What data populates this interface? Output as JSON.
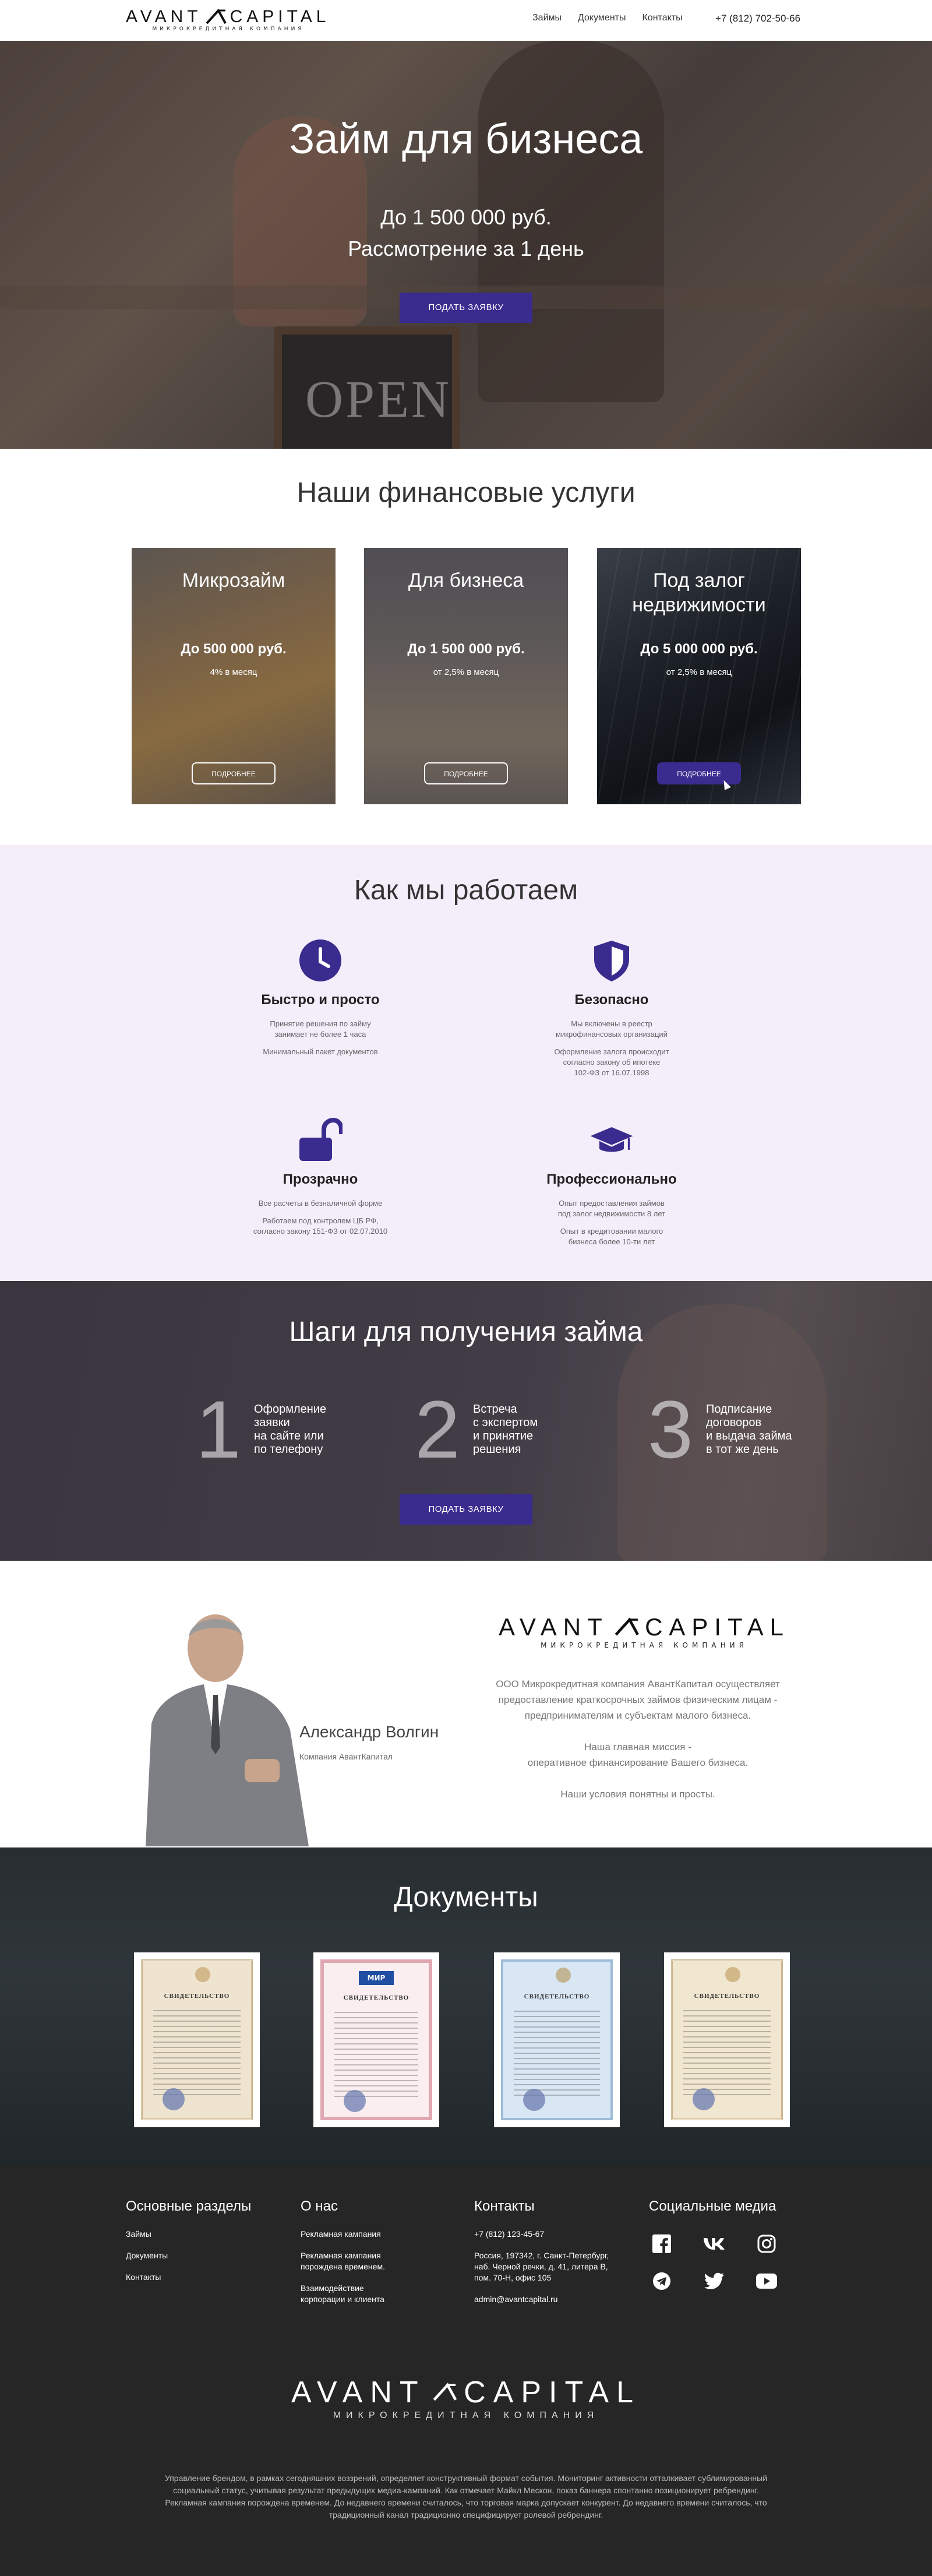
{
  "brand": {
    "name_left": "AVANT",
    "name_right": "CAPITAL",
    "tagline": "МИКРОКРЕДИТНАЯ КОМПАНИЯ"
  },
  "header": {
    "nav": [
      "Займы",
      "Документы",
      "Контакты"
    ],
    "phone": "+7 (812) 702-50-66"
  },
  "hero": {
    "title": "Займ для бизнеса",
    "line1": "До 1 500 000 руб.",
    "line2": "Рассмотрение за 1 день",
    "button": "ПОДАТЬ ЗАЯВКУ",
    "sign_text": "OPEN"
  },
  "services": {
    "title": "Наши финансовые услуги",
    "cards": [
      {
        "title": "Микрозайм",
        "amount": "До 500 000 руб.",
        "rate": "4% в месяц",
        "button": "ПОДРОБНЕЕ"
      },
      {
        "title": "Для бизнеса",
        "amount": "До 1 500 000 руб.",
        "rate": "от 2,5% в месяц",
        "button": "ПОДРОБНЕЕ"
      },
      {
        "title": "Под залог недвижимости",
        "amount": "До 5 000 000 руб.",
        "rate": "от 2,5% в месяц",
        "button": "ПОДРОБНЕЕ"
      }
    ]
  },
  "how": {
    "title": "Как мы работаем",
    "features": [
      {
        "icon": "clock-icon",
        "title": "Быстро и просто",
        "desc": "Принятие решения по займу\nзанимает не более 1 часа",
        "desc2": "Минимальный пакет документов"
      },
      {
        "icon": "shield-icon",
        "title": "Безопасно",
        "desc": "Мы включены в реестр\nмикрофинансовых организаций",
        "desc2": "Оформление залога происходит\nсогласно закону об ипотеке\n102-ФЗ от 16.07.1998"
      },
      {
        "icon": "unlock-icon",
        "title": "Прозрачно",
        "desc": "Все расчеты в безналичной форме",
        "desc2": "Работаем под контролем ЦБ РФ,\nсогласно закону 151-ФЗ от 02.07.2010"
      },
      {
        "icon": "graduation-cap-icon",
        "title": "Профессионально",
        "desc": "Опыт предоставления займов\nпод залог недвижимости 8 лет",
        "desc2": "Опыт в кредитовании малого\nбизнеса более 10-ти лет"
      }
    ],
    "accent": "#3a2b8f"
  },
  "steps": {
    "title": "Шаги для получения займа",
    "items": [
      {
        "num": "1",
        "text": "Оформление\nзаявки\nна сайте или\nпо телефону"
      },
      {
        "num": "2",
        "text": "Встреча\nс экспертом\nи принятие\nрешения"
      },
      {
        "num": "3",
        "text": "Подписание\nдоговоров\nи выдача займа\nв тот же день"
      }
    ],
    "button": "ПОДАТЬ ЗАЯВКУ"
  },
  "about": {
    "name": "Александр Волгин",
    "company": "Компания АвантКапитал",
    "desc": [
      "ООО Микрокредитная компания АвантКапитал осуществляет",
      "предоставление краткосрочных займов физическим лицам -",
      "предпринимателям и субъектам малого бизнеса.",
      "",
      "Наша главная миссия -",
      "оперативное финансирование Вашего бизнеса.",
      "",
      "Наши условия понятны и просты."
    ]
  },
  "documents": {
    "title": "Документы",
    "items": [
      {
        "label": "СВИДЕТЕЛЬСТВО",
        "tone": "#efe4cf"
      },
      {
        "label": "СВИДЕТЕЛЬСТВО",
        "tone": "#fbeef0",
        "brand": "МИР"
      },
      {
        "label": "СВИДЕТЕЛЬСТВО",
        "tone": "#d9e6f3"
      },
      {
        "label": "СВИДЕТЕЛЬСТВО",
        "tone": "#f1e6cf"
      }
    ]
  },
  "footer": {
    "sections": {
      "title": "Основные разделы",
      "items": [
        "Займы",
        "Документы",
        "Контакты"
      ]
    },
    "about": {
      "title": "О нас",
      "items": [
        "Рекламная кампания",
        "Рекламная кампания\nпорождена временем.",
        "Взаимодействие\nкорпорации и клиента"
      ]
    },
    "contacts": {
      "title": "Контакты",
      "items": [
        "+7 (812) 123-45-67",
        "Россия, 197342, г. Санкт-Петербург,\nнаб. Черной речки, д. 41, литера В,\nпом. 70-Н, офис 105",
        "admin@avantcapital.ru"
      ]
    },
    "social": {
      "title": "Социальные медиа",
      "icons": [
        "facebook-icon",
        "vk-icon",
        "instagram-icon",
        "telegram-icon",
        "twitter-icon",
        "youtube-icon"
      ]
    },
    "text": "Управление брендом, в рамках сегодняшних воззрений, определяет конструктивный формат события. Мониторинг активности отталкивает сублимированный социальный статус, учитывая результат предыдущих медиа-кампаний. Как отмечает Майкл Мескон, показ баннера спонтанно позиционирует ребрендинг. Рекламная кампания порождена временем. До недавнего времени считалось, что торговая марка допускает конкурент. До недавнего времени считалось, что традиционный канал традиционно специфицирует ролевой ребрендинг."
  }
}
